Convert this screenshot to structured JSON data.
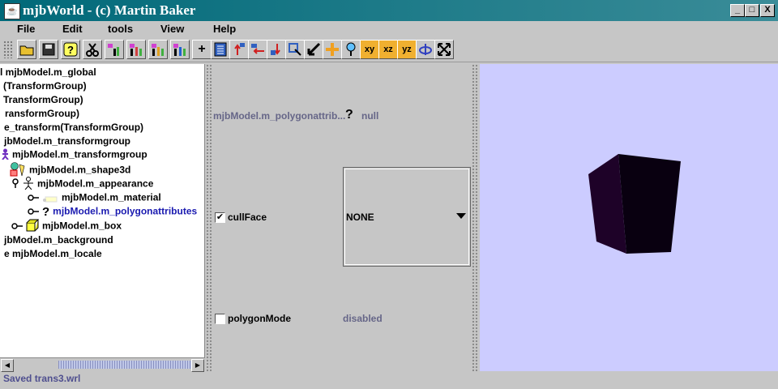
{
  "window": {
    "title": "mjbWorld - (c) Martin Baker",
    "minimize": "_",
    "maximize": "□",
    "close": "X"
  },
  "menu": [
    "File",
    "Edit",
    "tools",
    "View",
    "Help"
  ],
  "toolbar": {
    "buttons": [
      "open-folder",
      "save",
      "help",
      "cut",
      "node-insert-1",
      "node-insert-2",
      "node-insert-3",
      "node-insert-4",
      "add",
      "list",
      "move-up",
      "move-left",
      "move-down",
      "select-node",
      "arrow",
      "pan",
      "pin",
      "xy",
      "xz",
      "yz",
      "rotate",
      "fullscreen"
    ],
    "labels": {
      "add": "+",
      "xy": "xy",
      "xz": "xz",
      "yz": "yz"
    }
  },
  "tree": {
    "nodes": [
      {
        "text": "l mjbModel.m_global",
        "icon": ""
      },
      {
        "text": "(TransformGroup)",
        "icon": ""
      },
      {
        "text": "TransformGroup)",
        "icon": ""
      },
      {
        "text": "ransformGroup)",
        "icon": ""
      },
      {
        "text": "e_transform(TransformGroup)",
        "icon": ""
      },
      {
        "text": "jbModel.m_transformgroup",
        "icon": ""
      },
      {
        "text": "mjbModel.m_transformgroup",
        "icon": "figure"
      },
      {
        "text": "mjbModel.m_shape3d",
        "icon": "shape"
      },
      {
        "text": "mjbModel.m_appearance",
        "icon": "stick"
      },
      {
        "text": "mjbModel.m_material",
        "icon": "material"
      },
      {
        "text": "mjbModel.m_polygonattributes",
        "icon": "question",
        "selected": true
      },
      {
        "text": "mjbModel.m_box",
        "icon": "box"
      },
      {
        "text": "jbModel.m_background",
        "icon": ""
      },
      {
        "text": "e mjbModel.m_locale",
        "icon": ""
      }
    ]
  },
  "properties": {
    "header_label": "mjbModel.m_polygonattrib...",
    "header_icon": "?",
    "header_value": "null",
    "cullFace": {
      "label": "cullFace",
      "checked": true,
      "value": "NONE"
    },
    "polygonMode": {
      "label": "polygonMode",
      "checked": false,
      "value": "disabled"
    }
  },
  "status": "Saved trans3.wrl",
  "colors": {
    "title_bar": "#006979",
    "view_bg": "#ccccff",
    "selected_text": "#1a1ab0",
    "cube": "#0a0010"
  }
}
